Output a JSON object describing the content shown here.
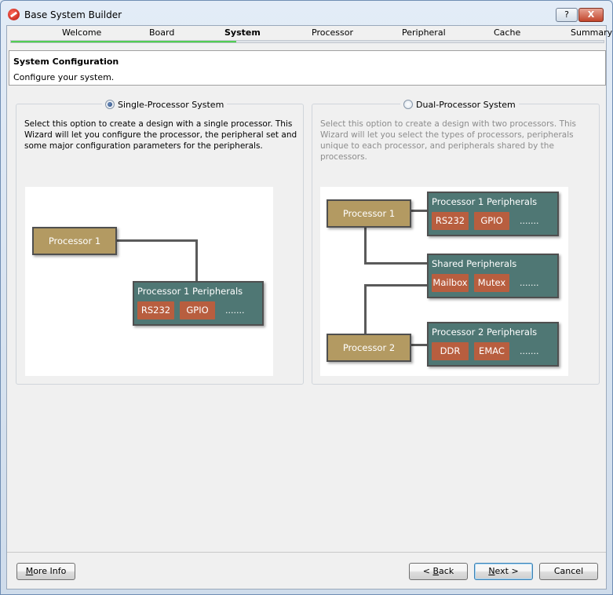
{
  "window": {
    "title": "Base System Builder",
    "help_label": "?",
    "close_label": "X"
  },
  "steps": [
    {
      "label": "Welcome"
    },
    {
      "label": "Board"
    },
    {
      "label": "System"
    },
    {
      "label": "Processor"
    },
    {
      "label": "Peripheral"
    },
    {
      "label": "Cache"
    },
    {
      "label": "Summary"
    }
  ],
  "active_step": "System",
  "progress_fraction": 0.38,
  "header": {
    "title": "System Configuration",
    "subtitle": "Configure your system."
  },
  "single": {
    "label": "Single-Processor System",
    "selected": true,
    "description": "Select this option to create a design with a single processor. This Wizard will let you configure the processor, the peripheral set and some major configuration parameters for the peripherals.",
    "processor_label": "Processor 1",
    "peripherals_title": "Processor 1 Peripherals",
    "chips": [
      "RS232",
      "GPIO"
    ],
    "more": "......."
  },
  "dual": {
    "label": "Dual-Processor System",
    "selected": false,
    "description": "Select this option to create a design with two processors. This Wizard will let you select the types of processors, peripherals unique to each processor, and peripherals shared by the processors.",
    "processor1_label": "Processor 1",
    "processor2_label": "Processor 2",
    "p1_peripherals_title": "Processor 1 Peripherals",
    "p1_chips": [
      "RS232",
      "GPIO"
    ],
    "shared_title": "Shared Peripherals",
    "shared_chips": [
      "Mailbox",
      "Mutex"
    ],
    "p2_peripherals_title": "Processor 2 Peripherals",
    "p2_chips": [
      "DDR",
      "EMAC"
    ],
    "more": "......."
  },
  "buttons": {
    "more_info": {
      "pre": "",
      "u": "M",
      "post": "ore Info"
    },
    "back": {
      "pre": "< ",
      "u": "B",
      "post": "ack"
    },
    "next": {
      "pre": "",
      "u": "N",
      "post": "ext >"
    },
    "cancel": {
      "pre": "",
      "u": "",
      "post": "Cancel"
    }
  },
  "colors": {
    "processor": "#b39a62",
    "peripherals": "#4f7774",
    "chip": "#b85e3f",
    "progress": "#23b823"
  }
}
